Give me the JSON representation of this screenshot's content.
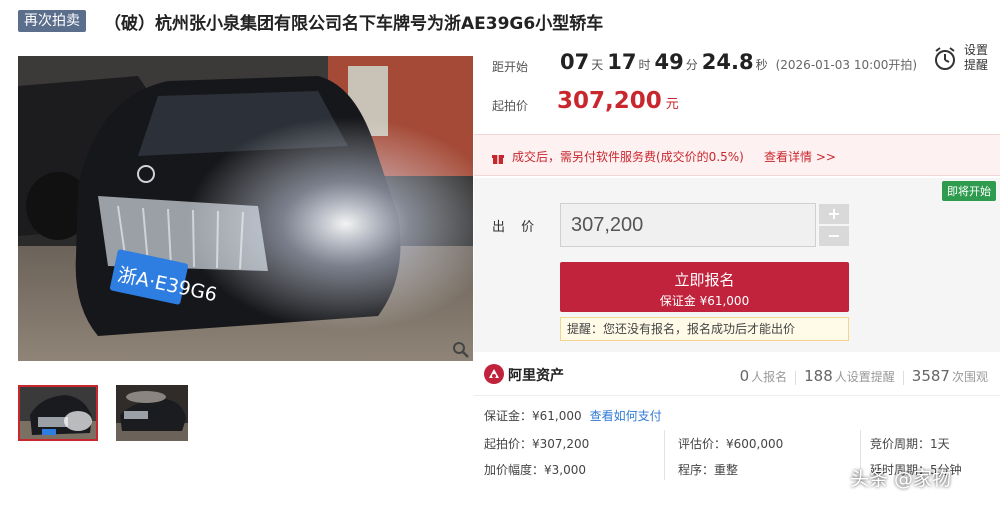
{
  "header": {
    "badge": "再次拍卖",
    "title": "（破）杭州张小泉集团有限公司名下车牌号为浙AE39G6小型轿车"
  },
  "gallery": {
    "plate_text": "浙A·E39G6",
    "thumbnails": [
      "thumb-1",
      "thumb-2"
    ]
  },
  "countdown": {
    "label": "距开始",
    "days": "07",
    "days_unit": "天",
    "hours": "17",
    "hours_unit": "时",
    "minutes": "49",
    "minutes_unit": "分",
    "seconds": "24.8",
    "seconds_unit": "秒",
    "start_time": "(2026-01-03 10:00开拍)"
  },
  "reminder": {
    "label_line1": "设置",
    "label_line2": "提醒"
  },
  "start_price": {
    "label": "起拍价",
    "value": "307,200",
    "unit": "元"
  },
  "notice": {
    "text": "成交后，需另付软件服务费(成交价的0.5%)",
    "link": "查看详情 >>"
  },
  "bid": {
    "status_tag": "即将开始",
    "label": "出 价",
    "value": "307,200",
    "plus": "+",
    "minus": "−",
    "button_main": "立即报名",
    "button_sub": "保证金 ¥61,000",
    "tip": "提醒：您还没有报名，报名成功后才能出价"
  },
  "platform": {
    "name": "阿里资产"
  },
  "stats": {
    "signups": "0",
    "signups_label": "人报名",
    "reminders": "188",
    "reminders_label": "人设置提醒",
    "views": "3587",
    "views_label": "次围观"
  },
  "info": {
    "deposit": "保证金：¥61,000",
    "deposit_link": "查看如何支付",
    "start_price": "起拍价：¥307,200",
    "increment": "加价幅度：¥3,000",
    "appraisal": "评估价：¥600,000",
    "procedure": "程序：重整",
    "cycle": "竞价周期：1天",
    "extension": "延时周期：5分钟"
  },
  "watermark": "头条 @家物",
  "colors": {
    "accent_red": "#c1223c",
    "price_red": "#c9272e",
    "badge_blue": "#5b6e8c",
    "tag_green": "#2e9b4e",
    "link_blue": "#2f7bd6"
  }
}
